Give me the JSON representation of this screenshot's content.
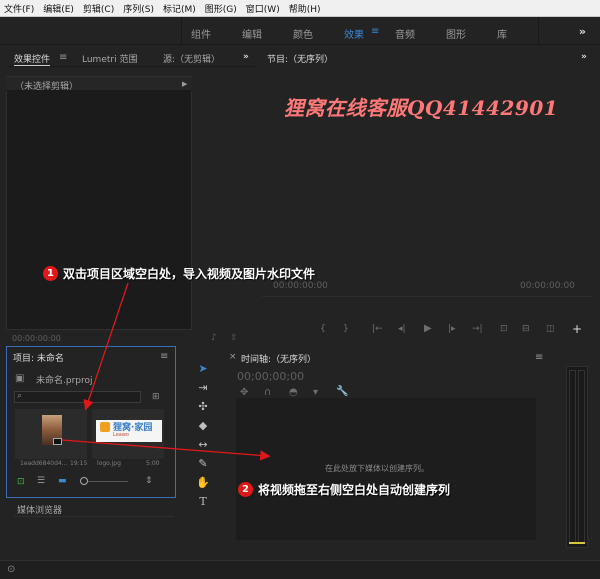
{
  "menubar": {
    "items": [
      "文件(F)",
      "编辑(E)",
      "剪辑(C)",
      "序列(S)",
      "标记(M)",
      "图形(G)",
      "窗口(W)",
      "帮助(H)"
    ]
  },
  "workspaces": {
    "tabs": [
      "组件",
      "编辑",
      "颜色",
      "效果",
      "音频",
      "图形",
      "库"
    ],
    "active": "效果",
    "more": "»"
  },
  "effect_panel": {
    "tab_effects": "效果控件",
    "tab_lumetri": "Lumetri 范围",
    "tab_source": "源:（无剪辑）",
    "no_clip": "（未选择剪辑）",
    "timecode": "00:00:00:00"
  },
  "program_panel": {
    "title": "节目:（无序列）",
    "timecode_left": "00:00:00:00",
    "timecode_right": "00:00:00:00"
  },
  "watermark": {
    "text": "狸窝在线客服QQ41442901",
    "color": "#ff7878"
  },
  "project_panel": {
    "title": "项目: 未命名",
    "file": "未命名.prproj",
    "items": [
      {
        "name": "1eadd6840d4...",
        "duration": "19:15"
      },
      {
        "name": "logo.jpg",
        "duration": "5:00"
      }
    ],
    "logo_text": "狸窝·家园",
    "logo_sub": "Leawo"
  },
  "media_browser": {
    "title": "媒体浏览器"
  },
  "timeline_panel": {
    "title": "时间轴:（无序列）",
    "timecode": "00;00;00;00",
    "drop_hint": "在此处放下媒体以创建序列。"
  },
  "annotations": {
    "step1": {
      "num": "1",
      "text": "双击项目区域空白处，导入视频及图片水印文件"
    },
    "step2": {
      "num": "2",
      "text": "将视频拖至右侧空白处自动创建序列"
    },
    "arrow_color": "#e01818"
  },
  "colors": {
    "accent": "#3a88d6",
    "selection_border": "#3a6fb5",
    "meter_yellow": "#d6c83a"
  }
}
